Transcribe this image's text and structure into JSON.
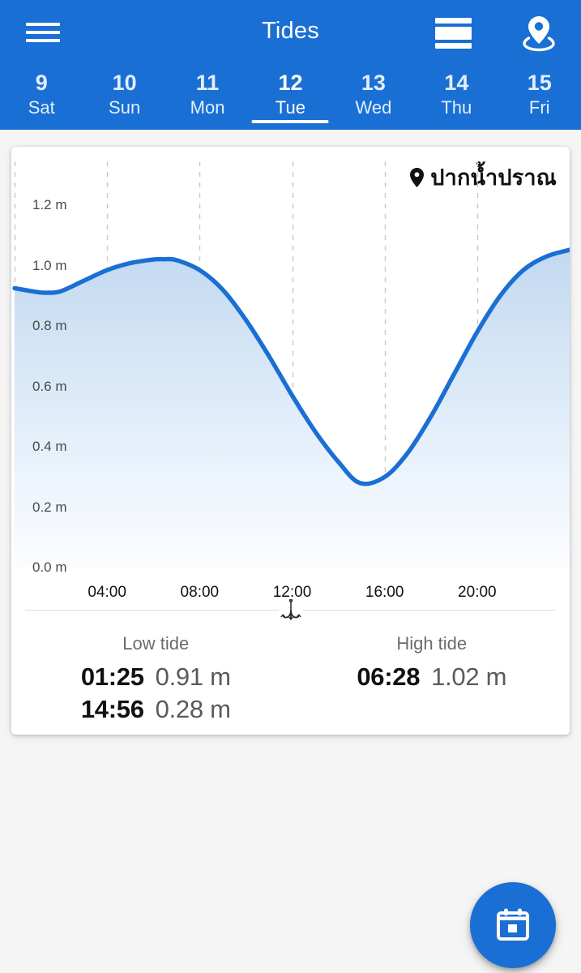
{
  "app": {
    "title": "Tides",
    "accent_color": "#1a6fd4",
    "menu_icon": "hamburger-menu-icon",
    "table_icon": "table-view-icon",
    "location_icon": "location-pin-icon"
  },
  "date_tabs": [
    {
      "day": "9",
      "weekday": "Sat",
      "selected": false
    },
    {
      "day": "10",
      "weekday": "Sun",
      "selected": false
    },
    {
      "day": "11",
      "weekday": "Mon",
      "selected": false
    },
    {
      "day": "12",
      "weekday": "Tue",
      "selected": true
    },
    {
      "day": "13",
      "weekday": "Wed",
      "selected": false
    },
    {
      "day": "14",
      "weekday": "Thu",
      "selected": false
    },
    {
      "day": "15",
      "weekday": "Fri",
      "selected": false
    }
  ],
  "station": {
    "name": "ปากน้ำปราณ",
    "pin_icon": "location-pin-icon"
  },
  "divider_icon": "fishing-hook-icon",
  "tides": {
    "low": {
      "heading": "Low tide",
      "entries": [
        {
          "time": "01:25",
          "height": "0.91 m"
        },
        {
          "time": "14:56",
          "height": "0.28 m"
        }
      ]
    },
    "high": {
      "heading": "High tide",
      "entries": [
        {
          "time": "06:28",
          "height": "1.02 m"
        }
      ]
    }
  },
  "fab": {
    "icon": "calendar-icon",
    "color": "#1a6fd4"
  },
  "chart_data": {
    "type": "area",
    "title": "",
    "xlabel": "",
    "ylabel": "",
    "unit": "m",
    "line_color": "#1a6fd4",
    "fill_color_top": "#c9ddf2",
    "fill_color_bottom": "#fbfdff",
    "grid": true,
    "grid_style": "dashed-vertical",
    "legend": "none",
    "ylim": [
      0.0,
      1.2
    ],
    "ytick_labels": [
      "0.0 m",
      "0.2 m",
      "0.4 m",
      "0.6 m",
      "0.8 m",
      "1.0 m",
      "1.2 m"
    ],
    "ytick_values": [
      0.0,
      0.2,
      0.4,
      0.6,
      0.8,
      1.0,
      1.2
    ],
    "xlim": [
      0,
      24
    ],
    "xtick_labels": [
      "04:00",
      "08:00",
      "12:00",
      "16:00",
      "20:00"
    ],
    "xtick_values": [
      4,
      8,
      12,
      16,
      20
    ],
    "x": [
      0,
      1.0,
      1.42,
      2.0,
      3.0,
      4.0,
      5.0,
      6.0,
      6.47,
      7.0,
      8.0,
      9.0,
      10.0,
      11.0,
      12.0,
      13.0,
      14.0,
      14.93,
      16.0,
      17.0,
      18.0,
      19.0,
      20.0,
      21.0,
      22.0,
      23.0,
      24.0
    ],
    "y": [
      0.925,
      0.912,
      0.91,
      0.915,
      0.95,
      0.985,
      1.008,
      1.02,
      1.021,
      1.018,
      0.985,
      0.92,
      0.82,
      0.7,
      0.57,
      0.45,
      0.35,
      0.28,
      0.3,
      0.38,
      0.5,
      0.64,
      0.78,
      0.9,
      0.985,
      1.03,
      1.052
    ],
    "annotations": [
      {
        "label": "Low tide",
        "time": "01:25",
        "value": 0.91
      },
      {
        "label": "High tide",
        "time": "06:28",
        "value": 1.02
      },
      {
        "label": "Low tide",
        "time": "14:56",
        "value": 0.28
      }
    ]
  }
}
